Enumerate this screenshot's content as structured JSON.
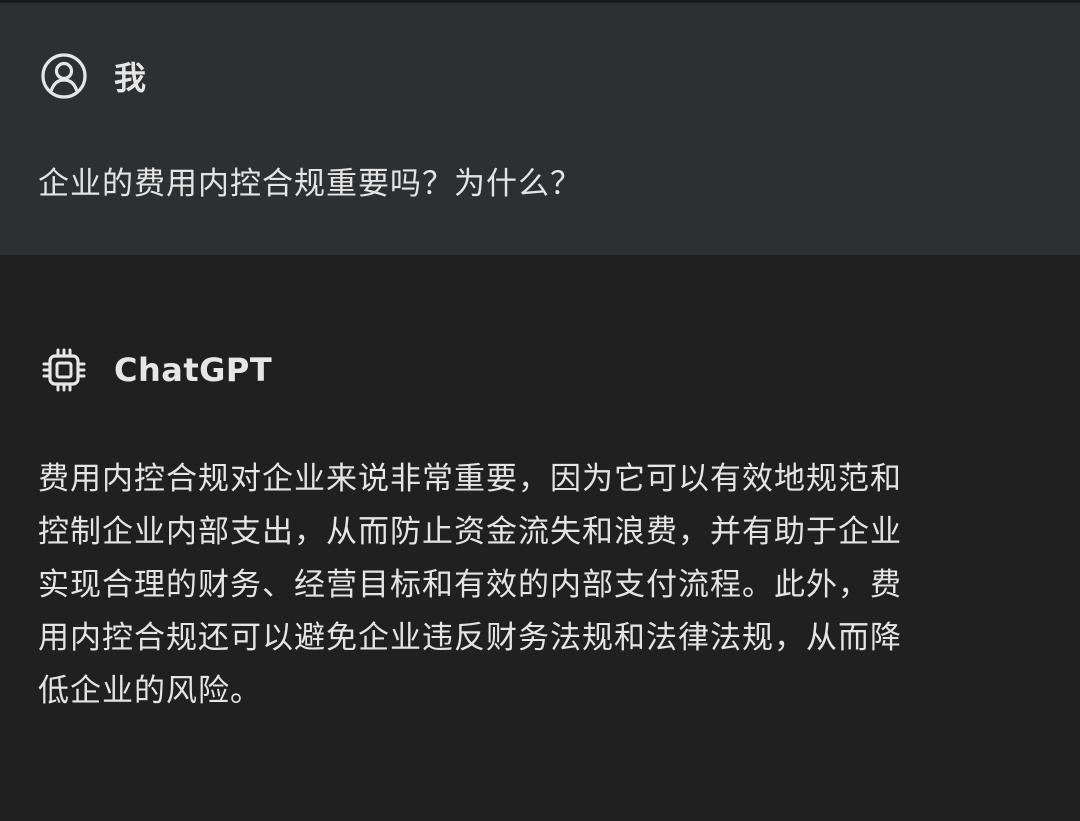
{
  "conversation": {
    "user_message": {
      "author": "我",
      "icon": "user-circle-icon",
      "text": "企业的费用内控合规重要吗？为什么？"
    },
    "assistant_message": {
      "author": "ChatGPT",
      "icon": "chip-icon",
      "lines": [
        "费用内控合规对企业来说非常重要，因为它可以有效地规范和",
        "控制企业内部支出，从而防止资金流失和浪费，并有助于企业",
        "实现合理的财务、经营目标和有效的内部支付流程。此外，费",
        "用内控合规还可以避免企业违反财务法规和法律法规，从而降",
        "低企业的风险。"
      ]
    }
  },
  "colors": {
    "user_bg": "#2e2f31",
    "assistant_bg": "#202020",
    "text": "#e4e4e4"
  }
}
